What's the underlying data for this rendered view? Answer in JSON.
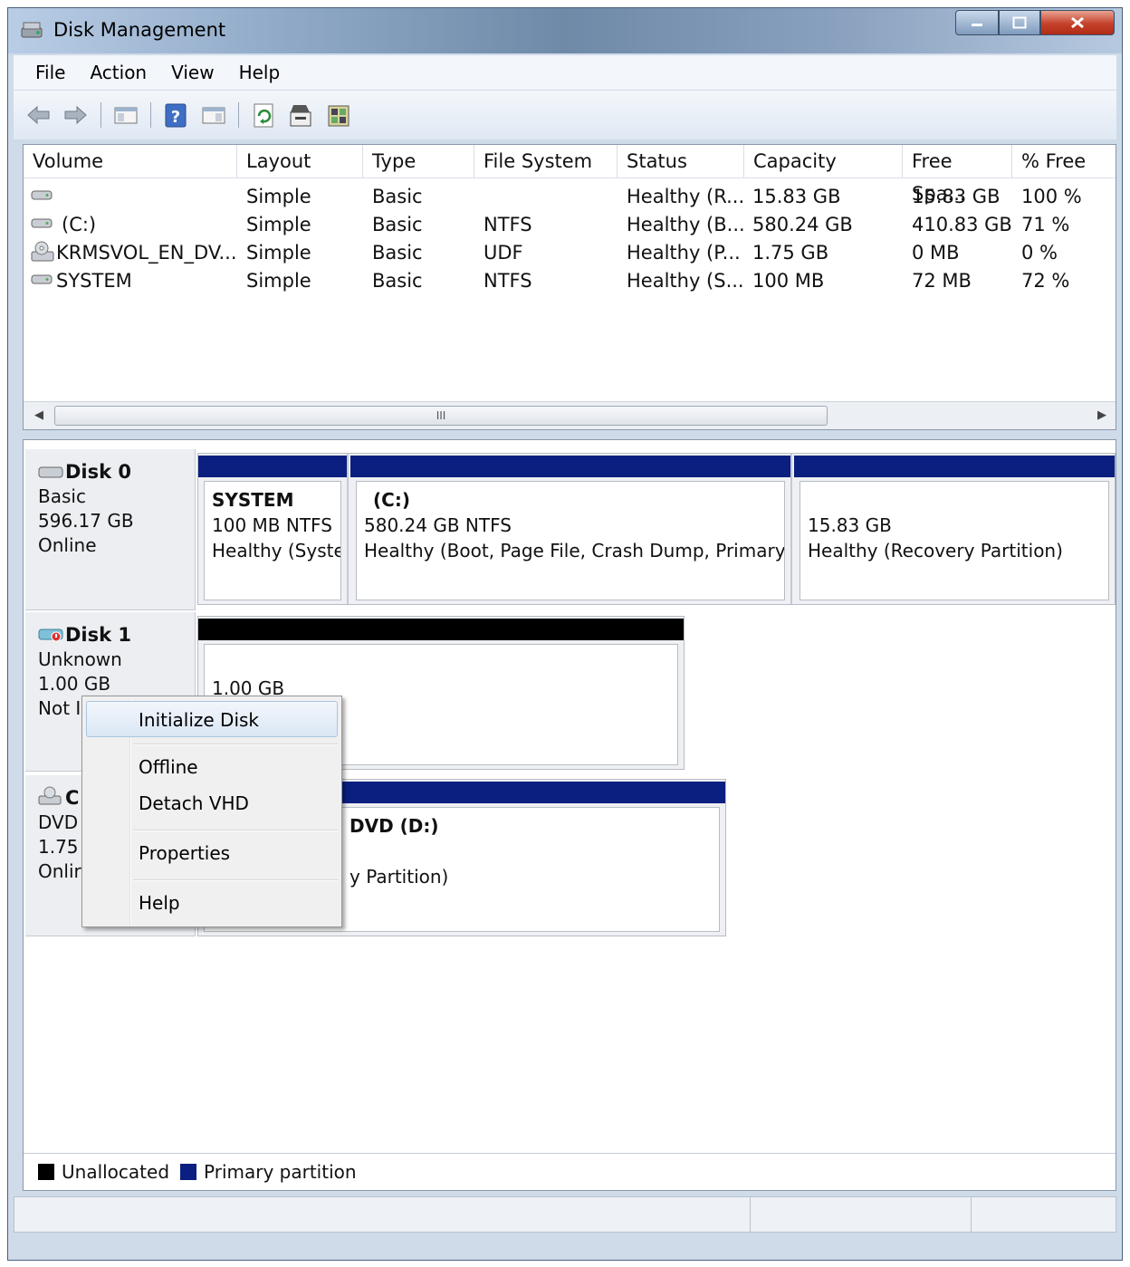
{
  "window": {
    "title": "Disk Management"
  },
  "menu": [
    "File",
    "Action",
    "View",
    "Help"
  ],
  "volumes": {
    "columns": [
      "Volume",
      "Layout",
      "Type",
      "File System",
      "Status",
      "Capacity",
      "Free Spa...",
      "% Free"
    ],
    "rows": [
      {
        "volume": "",
        "layout": "Simple",
        "type": "Basic",
        "fs": "",
        "status": "Healthy (R...",
        "capacity": "15.83 GB",
        "free": "15.83 GB",
        "pct": "100 %"
      },
      {
        "volume": "(C:)",
        "layout": "Simple",
        "type": "Basic",
        "fs": "NTFS",
        "status": "Healthy (B...",
        "capacity": "580.24 GB",
        "free": "410.83 GB",
        "pct": "71 %"
      },
      {
        "volume": "KRMSVOL_EN_DV...",
        "layout": "Simple",
        "type": "Basic",
        "fs": "UDF",
        "status": "Healthy (P...",
        "capacity": "1.75 GB",
        "free": "0 MB",
        "pct": "0 %"
      },
      {
        "volume": "SYSTEM",
        "layout": "Simple",
        "type": "Basic",
        "fs": "NTFS",
        "status": "Healthy (S...",
        "capacity": "100 MB",
        "free": "72 MB",
        "pct": "72 %"
      }
    ],
    "scroll_grip": "III"
  },
  "disks": {
    "disk0": {
      "name": "Disk 0",
      "kind": "Basic",
      "size": "596.17 GB",
      "state": "Online",
      "partitions": [
        {
          "name": "SYSTEM",
          "size": "100 MB NTFS",
          "status": "Healthy (Syste"
        },
        {
          "name": "(C:)",
          "size": "580.24 GB NTFS",
          "status": "Healthy (Boot, Page File, Crash Dump, Primary P"
        },
        {
          "name": "",
          "size": "15.83 GB",
          "status": "Healthy (Recovery Partition)"
        }
      ]
    },
    "disk1": {
      "name": "Disk 1",
      "kind": "Unknown",
      "size": "1.00 GB",
      "state": "Not I",
      "partition": {
        "size": "1.00 GB"
      }
    },
    "cdrom": {
      "name": "C",
      "kind": "DVD",
      "size": "1.75 (",
      "state": "Onlir",
      "partition": {
        "name": "DVD (D:)",
        "status": "y Partition)"
      }
    }
  },
  "legend": [
    {
      "label": "Unallocated",
      "color": "#000000"
    },
    {
      "label": "Primary partition",
      "color": "#0a1f80"
    }
  ],
  "context_menu": {
    "items": [
      "Initialize Disk",
      "Offline",
      "Detach VHD",
      "Properties",
      "Help"
    ],
    "highlighted": "Initialize Disk"
  },
  "colors": {
    "primary_partition": "#0a1f80",
    "unallocated": "#000000"
  }
}
